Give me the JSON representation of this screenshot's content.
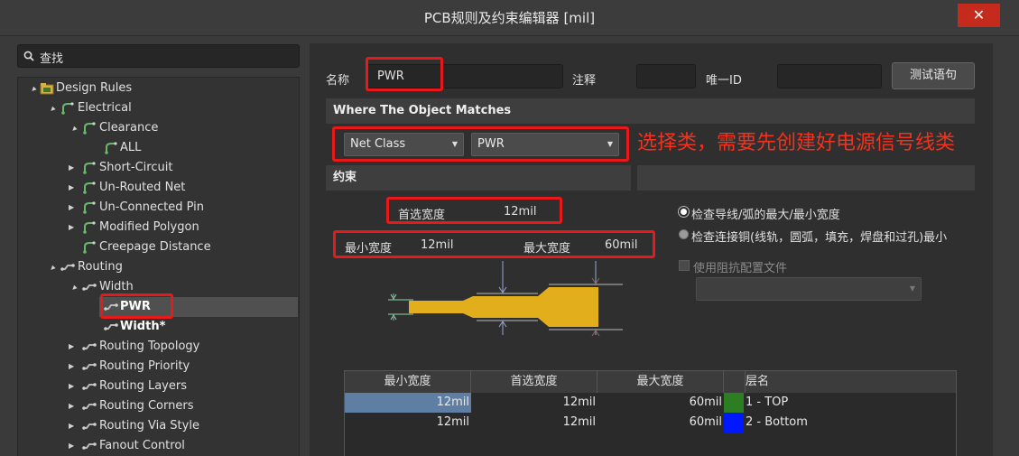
{
  "window": {
    "title": "PCB规则及约束编辑器 [mil]",
    "close_glyph": "✕"
  },
  "search": {
    "placeholder": "查找"
  },
  "tree": {
    "design_rules": "Design Rules",
    "electrical": "Electrical",
    "clearance": "Clearance",
    "all": "ALL",
    "short_circuit": "Short-Circuit",
    "unrouted_net": "Un-Routed Net",
    "unconnected_pin": "Un-Connected Pin",
    "modified_polygon": "Modified Polygon",
    "creepage_distance": "Creepage Distance",
    "routing": "Routing",
    "width": "Width",
    "pwr": "PWR",
    "width_star": "Width*",
    "routing_topology": "Routing Topology",
    "routing_priority": "Routing Priority",
    "routing_layers": "Routing Layers",
    "routing_corners": "Routing Corners",
    "routing_via_style": "Routing Via Style",
    "fanout_control": "Fanout Control"
  },
  "rule": {
    "name_label": "名称",
    "name_value": "PWR",
    "comment_label": "注释",
    "comment_value": "",
    "uid_label": "唯一ID",
    "uid_value": "",
    "test_button": "测试语句"
  },
  "where": {
    "header": "Where The Object Matches",
    "type_value": "Net Class",
    "class_value": "PWR",
    "annotation": "选择类，需要先创建好电源信号线类"
  },
  "constraints": {
    "header": "约束",
    "preferred_label": "首选宽度",
    "preferred_value": "12mil",
    "min_label": "最小宽度",
    "min_value": "12mil",
    "max_label": "最大宽度",
    "max_value": "60mil",
    "option_1": "检查导线/弧的最大/最小宽度",
    "option_2": "检查连接铜(线轨，圆弧，填充，焊盘和过孔)最小",
    "option_3": "使用阻抗配置文件",
    "selected_option": 1,
    "trace_color": "#e2ae1c"
  },
  "grid": {
    "headers": [
      "最小宽度",
      "首选宽度",
      "最大宽度",
      "层名"
    ],
    "rows": [
      {
        "min": "12mil",
        "pref": "12mil",
        "max": "60mil",
        "layer": "1 - TOP",
        "color": "#2d7d22",
        "selected": true
      },
      {
        "min": "12mil",
        "pref": "12mil",
        "max": "60mil",
        "layer": "2 - Bottom",
        "color": "#0018ff",
        "selected": false
      }
    ]
  }
}
